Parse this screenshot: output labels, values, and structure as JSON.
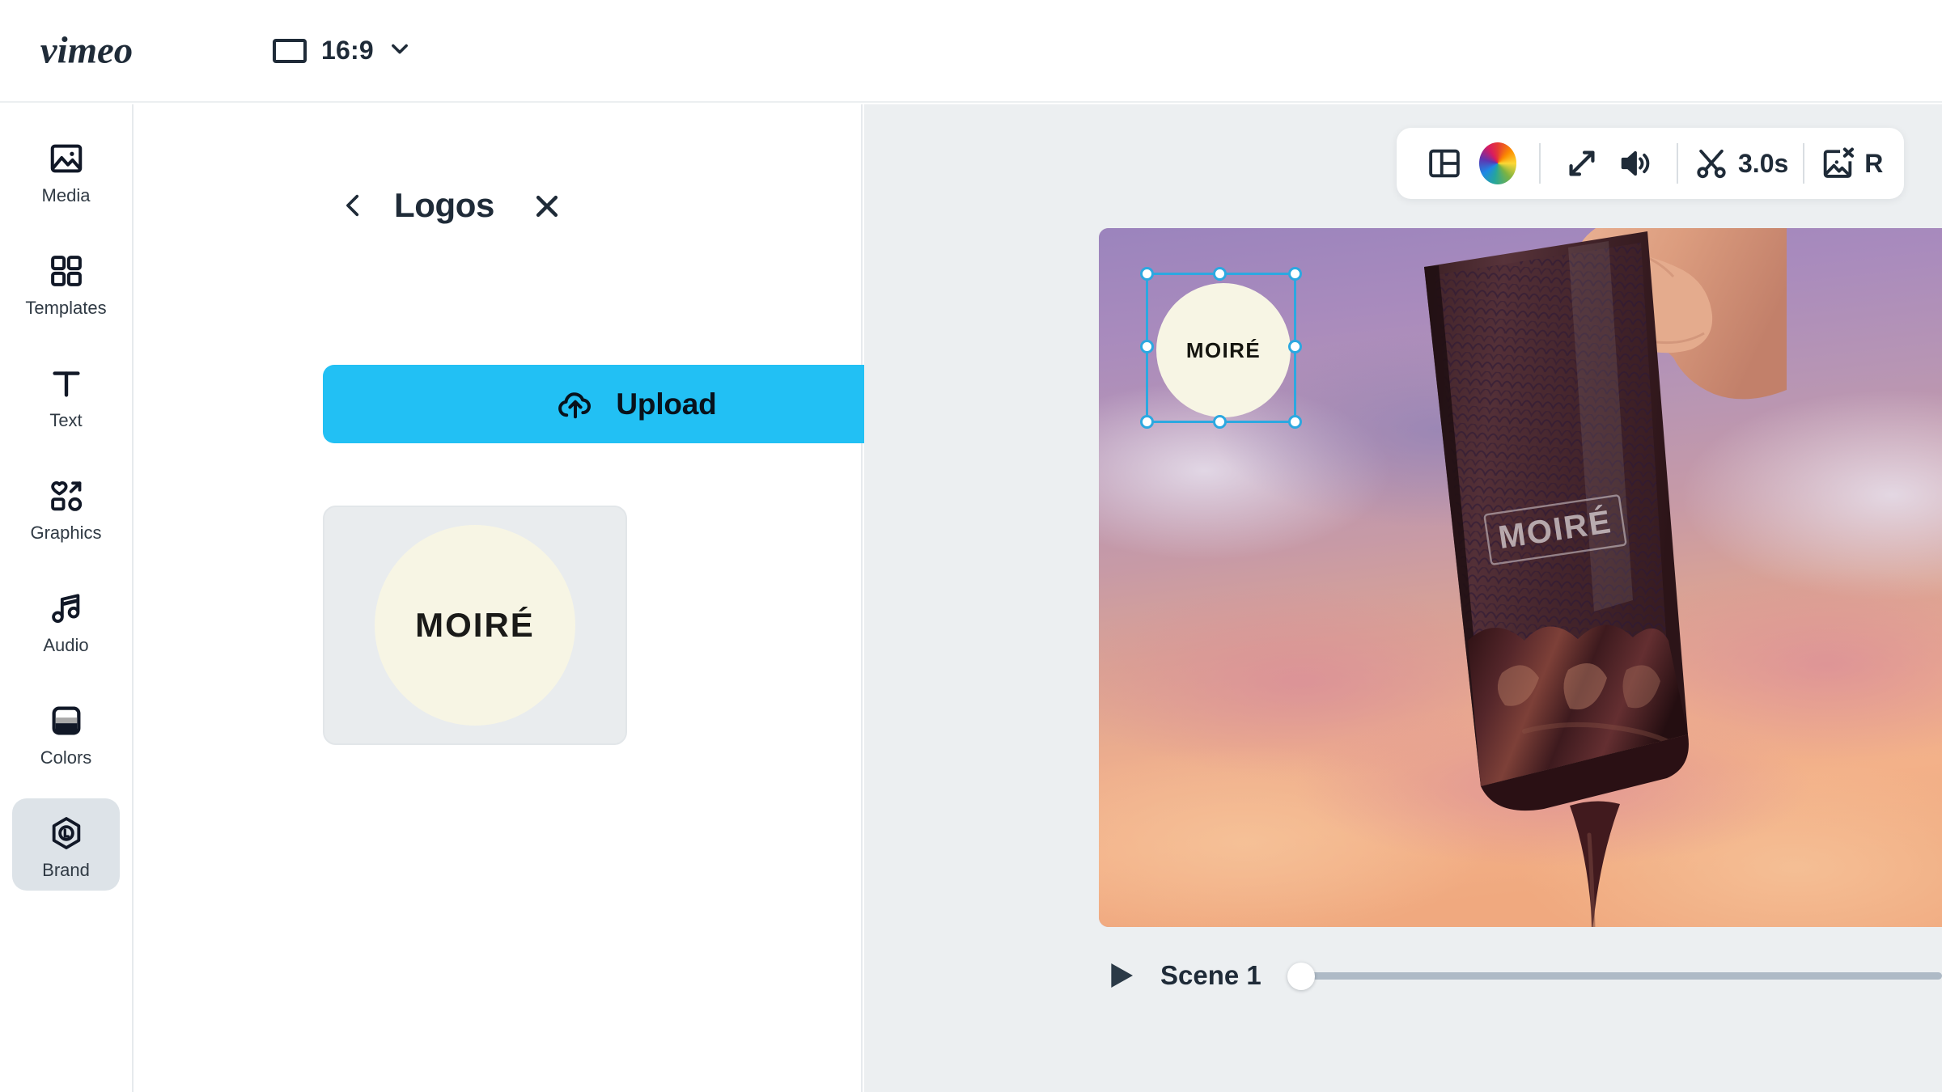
{
  "header": {
    "logo_text": "vimeo",
    "logo_icon": "vimeo-wordmark",
    "aspect_ratio": {
      "icon": "rectangle-icon",
      "label": "16:9",
      "chevron": "chevron-down-icon"
    }
  },
  "sidebar": {
    "items": [
      {
        "icon": "image-icon",
        "label": "Media",
        "active": false
      },
      {
        "icon": "grid-icon",
        "label": "Templates",
        "active": false
      },
      {
        "icon": "text-t-icon",
        "label": "Text",
        "active": false
      },
      {
        "icon": "shapes-icon",
        "label": "Graphics",
        "active": false
      },
      {
        "icon": "music-note-icon",
        "label": "Audio",
        "active": false
      },
      {
        "icon": "color-swatch-icon",
        "label": "Colors",
        "active": false
      },
      {
        "icon": "brand-hex-l-icon",
        "label": "Brand",
        "active": true
      }
    ]
  },
  "panel": {
    "back_icon": "chevron-left-icon",
    "title": "Logos",
    "close_icon": "close-icon",
    "upload": {
      "icon": "cloud-upload-icon",
      "label": "Upload"
    },
    "logos": [
      {
        "name": "MOIRÉ",
        "circle_color": "#f7f5e4",
        "card_color": "#e9ecee"
      }
    ]
  },
  "toolbar": {
    "items": [
      {
        "icon": "layout-split-icon",
        "label": ""
      },
      {
        "icon": "color-wheel-icon",
        "label": ""
      },
      {
        "icon": "resize-arrows-icon",
        "label": ""
      },
      {
        "icon": "volume-icon",
        "label": ""
      },
      {
        "icon": "scissors-icon",
        "label": "3.0s"
      },
      {
        "icon": "remove-image-icon",
        "label": "R"
      }
    ],
    "duration_label": "3.0s",
    "remove_label": "R"
  },
  "canvas": {
    "selected_element": {
      "type": "logo",
      "text": "MOIRÉ",
      "fill": "#f7f5e4",
      "selection_color": "#2ca8e0",
      "handles": 8
    },
    "media_description": "hand-holding-chocolate-bar-sunset"
  },
  "timeline": {
    "play_icon": "play-icon",
    "scene_label": "Scene 1",
    "playhead_position_percent": 0
  },
  "colors": {
    "accent_blue": "#22c0f4",
    "selection_blue": "#2ca8e0",
    "stage_bg": "#eceff1",
    "text_dark": "#1f2b38",
    "cream": "#f7f5e4"
  }
}
